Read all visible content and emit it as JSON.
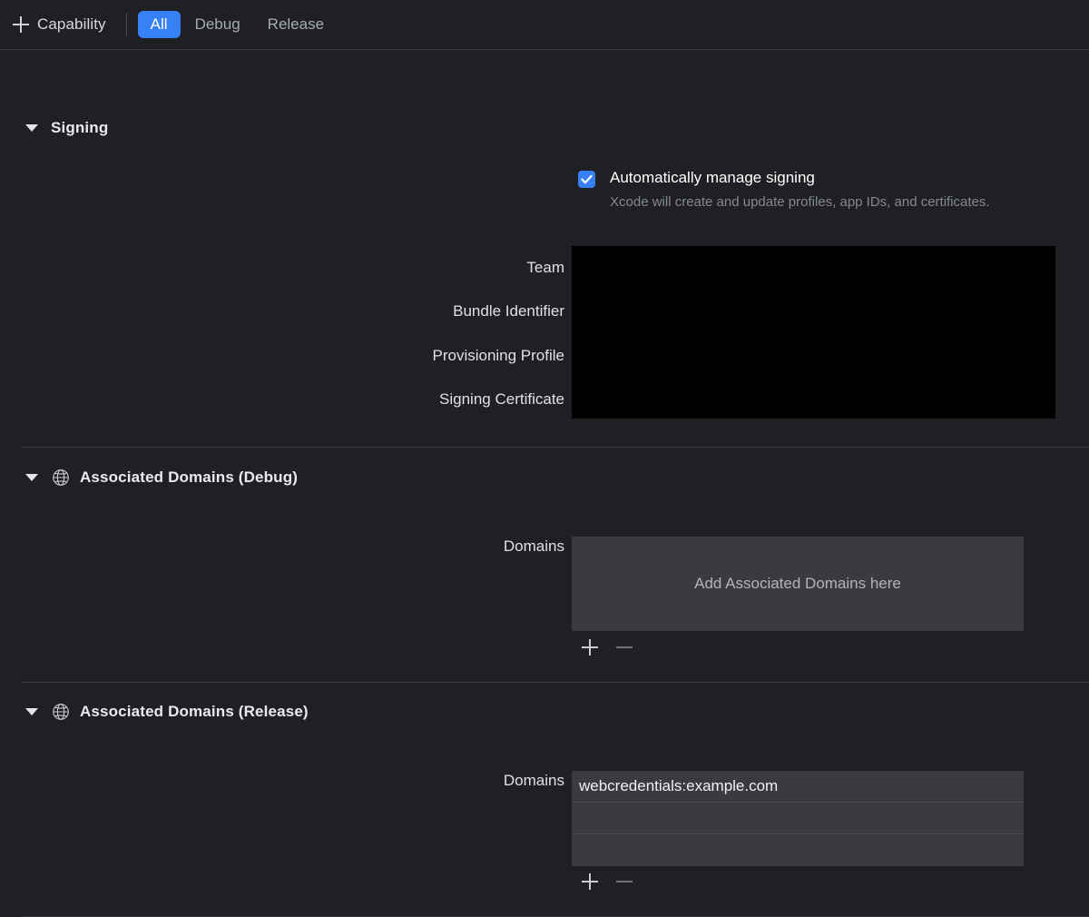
{
  "toolbar": {
    "add_capability_label": "Capability",
    "plus_icon": "plus-icon",
    "filters": [
      {
        "label": "All",
        "active": true
      },
      {
        "label": "Debug",
        "active": false
      },
      {
        "label": "Release",
        "active": false
      }
    ],
    "accent_color": "#3880f5"
  },
  "sections": {
    "signing": {
      "title": "Signing",
      "disclosure_icon": "chevron-down-icon",
      "auto_manage": {
        "label": "Automatically manage signing",
        "description": "Xcode will create and update profiles, app IDs, and certificates.",
        "checked": true,
        "checkbox_color": "#3880f5"
      },
      "fields": [
        {
          "label": "Team",
          "value": ""
        },
        {
          "label": "Bundle Identifier",
          "value": ""
        },
        {
          "label": "Provisioning Profile",
          "value": ""
        },
        {
          "label": "Signing Certificate",
          "value": ""
        }
      ],
      "redacted_note": "redacted-block"
    },
    "associated_domains_debug": {
      "title": "Associated Domains (Debug)",
      "icon": "globe-icon",
      "disclosure_icon": "chevron-down-icon",
      "domains_label": "Domains",
      "empty_placeholder": "Add Associated Domains here",
      "domains": [],
      "add_button_label": "add-domain",
      "remove_button_label": "remove-domain",
      "remove_enabled": false
    },
    "associated_domains_release": {
      "title": "Associated Domains (Release)",
      "icon": "globe-icon",
      "disclosure_icon": "chevron-down-icon",
      "domains_label": "Domains",
      "domains": [
        "webcredentials:example.com",
        "",
        ""
      ],
      "add_button_label": "add-domain",
      "remove_button_label": "remove-domain",
      "remove_enabled": false
    }
  }
}
